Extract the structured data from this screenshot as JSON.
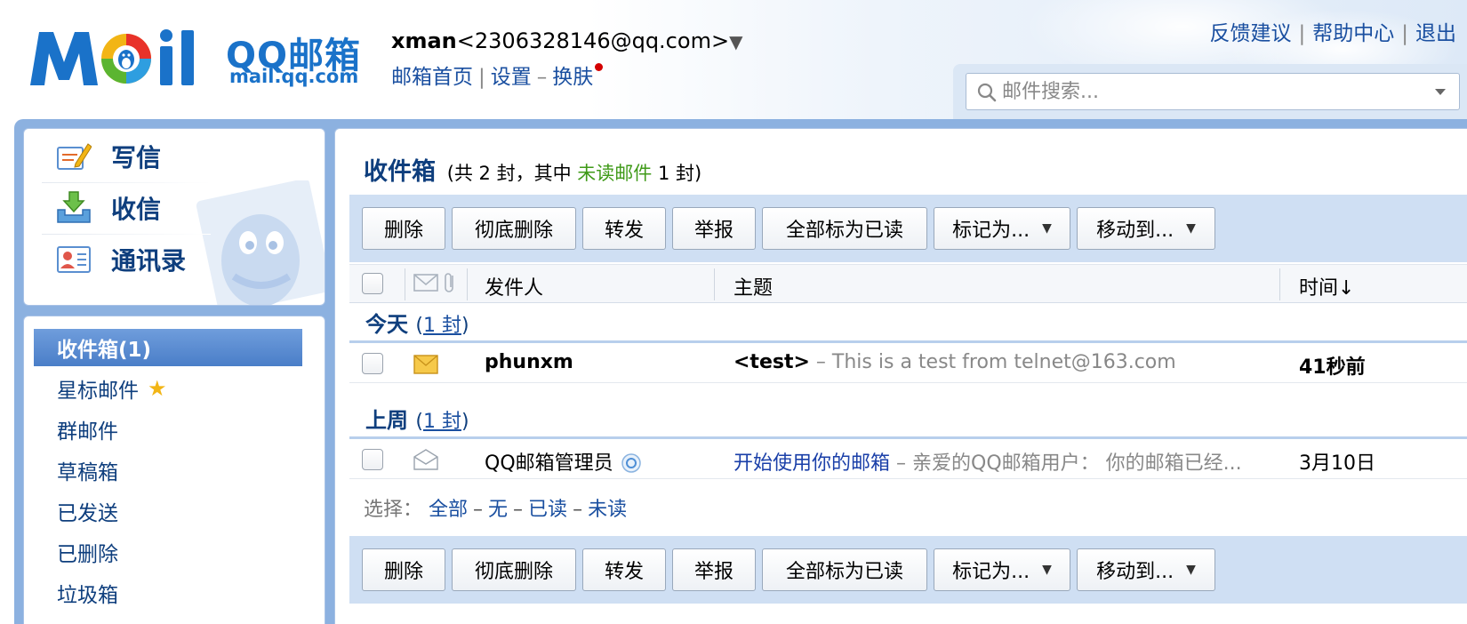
{
  "header": {
    "logo_cn": "QQ邮箱",
    "logo_en": "mail.qq.com",
    "user_name": "xman",
    "user_email": "<2306328146@qq.com>",
    "nav": {
      "home": "邮箱首页",
      "settings": "设置",
      "skin": "换肤"
    },
    "top_links": {
      "feedback": "反馈建议",
      "help": "帮助中心",
      "logout": "退出"
    },
    "search_placeholder": "邮件搜索..."
  },
  "quick_actions": [
    {
      "label": "写信",
      "icon": "compose-icon"
    },
    {
      "label": "收信",
      "icon": "inbox-download-icon"
    },
    {
      "label": "通讯录",
      "icon": "contacts-icon"
    }
  ],
  "folders": [
    {
      "label": "收件箱(1)",
      "active": true
    },
    {
      "label": "星标邮件"
    },
    {
      "label": "群邮件"
    },
    {
      "label": "草稿箱"
    },
    {
      "label": "已发送"
    },
    {
      "label": "已删除"
    },
    {
      "label": "垃圾箱"
    }
  ],
  "inbox": {
    "title": "收件箱",
    "summary_prefix": "(共 2 封，其中",
    "unread_label": "未读邮件",
    "summary_suffix": "1 封)"
  },
  "toolbar": {
    "delete": "删除",
    "delete_forever": "彻底删除",
    "forward": "转发",
    "report": "举报",
    "mark_all_read": "全部标为已读",
    "mark_as": "标记为...",
    "move_to": "移动到..."
  },
  "columns": {
    "sender": "发件人",
    "subject": "主题",
    "time": "时间↓"
  },
  "groups": [
    {
      "label": "今天",
      "count": "(1 封)",
      "count_paren_open": "(",
      "count_text": "1 封",
      "count_paren_close": ")",
      "messages": [
        {
          "sender": "phunxm",
          "subject": "<test>",
          "preview": "This is a test from telnet@163.com",
          "time": "41秒前",
          "unread": true
        }
      ]
    },
    {
      "label": "上周",
      "count_paren_open": "(",
      "count_text": "1 封",
      "count_paren_close": ")",
      "messages": [
        {
          "sender": "QQ邮箱管理员",
          "subject": "开始使用你的邮箱",
          "preview": "亲爱的QQ邮箱用户： 你的邮箱已经...",
          "time": "3月10日",
          "unread": false
        }
      ]
    }
  ],
  "select_bar": {
    "label": "选择：",
    "all": "全部",
    "none": "无",
    "read": "已读",
    "unread": "未读"
  },
  "colors": {
    "brand_blue": "#1a72c9",
    "link_blue": "#1a4fa0",
    "unread_green": "#3f9a18",
    "frame_blue": "#8cb1e0",
    "active_folder": "#4a7ec8"
  }
}
